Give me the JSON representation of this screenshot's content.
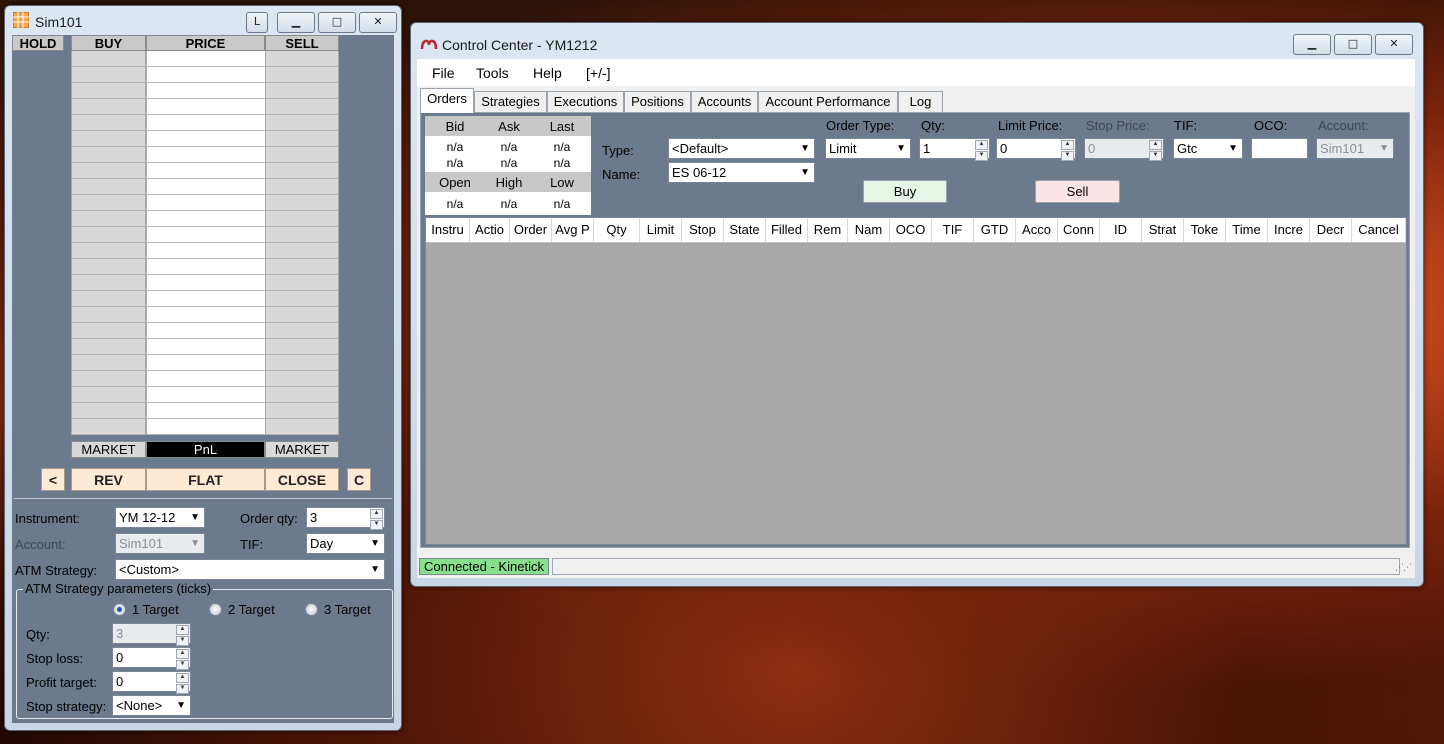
{
  "superdom": {
    "title": "Sim101",
    "lock_label": "L",
    "minimize_label": "▁",
    "maximize_label": "□",
    "close_label": "✕",
    "columns": [
      "HOLD",
      "BUY",
      "PRICE",
      "SELL"
    ],
    "bottom_labels": {
      "left": "MARKET",
      "center": "PnL",
      "right": "MARKET"
    },
    "actions": {
      "prev": "<",
      "rev": "REV",
      "flat": "FLAT",
      "close": "CLOSE",
      "c": "C"
    },
    "instrument_label": "Instrument:",
    "instrument_value": "YM 12-12",
    "order_qty_label": "Order qty:",
    "order_qty_value": "3",
    "account_label": "Account:",
    "account_value": "Sim101",
    "tif_label": "TIF:",
    "tif_value": "Day",
    "atm_label": "ATM Strategy:",
    "atm_value": "<Custom>",
    "atm_group_label": "ATM Strategy parameters (ticks)",
    "targets": [
      "1 Target",
      "2 Target",
      "3 Target"
    ],
    "selected_target": 0,
    "qty_label": "Qty:",
    "qty_value": "3",
    "stop_loss_label": "Stop loss:",
    "stop_loss_value": "0",
    "profit_target_label": "Profit target:",
    "profit_target_value": "0",
    "stop_strategy_label": "Stop strategy:",
    "stop_strategy_value": "<None>"
  },
  "control_center": {
    "title": "Control Center - YM1212",
    "menu": [
      "File",
      "Tools",
      "Help",
      "[+/-]"
    ],
    "tabs": [
      "Orders",
      "Strategies",
      "Executions",
      "Positions",
      "Accounts",
      "Account Performance",
      "Log"
    ],
    "active_tab": "Orders",
    "quote": {
      "headers1": [
        "Bid",
        "Ask",
        "Last"
      ],
      "row1": [
        "n/a",
        "n/a",
        "n/a"
      ],
      "row2": [
        "n/a",
        "n/a",
        "n/a"
      ],
      "headers2": [
        "Open",
        "High",
        "Low"
      ],
      "row3": [
        "n/a",
        "n/a",
        "n/a"
      ]
    },
    "order_form": {
      "type_label": "Type:",
      "type_value": "<Default>",
      "name_label": "Name:",
      "name_value": "ES 06-12",
      "order_type_label": "Order Type:",
      "order_type_value": "Limit",
      "qty_label": "Qty:",
      "qty_value": "1",
      "limit_price_label": "Limit Price:",
      "limit_price_value": "0",
      "stop_price_label": "Stop Price:",
      "stop_price_value": "0",
      "tif_label": "TIF:",
      "tif_value": "Gtc",
      "oco_label": "OCO:",
      "oco_value": "",
      "account_label": "Account:",
      "account_value": "Sim101",
      "buy_label": "Buy",
      "sell_label": "Sell"
    },
    "grid_columns": [
      "Instru",
      "Actio",
      "Order",
      "Avg P",
      "Qty",
      "Limit",
      "Stop",
      "State",
      "Filled",
      "Rem",
      "Nam",
      "OCO",
      "TIF",
      "GTD",
      "Acco",
      "Conn",
      "ID",
      "Strat",
      "Toke",
      "Time",
      "Incre",
      "Decr",
      "Cancel"
    ],
    "status": "Connected - Kinetick"
  },
  "colors": {
    "panel": "#6c7a8d",
    "flat_buttons": "#fde9d4",
    "connected": "#88e08c",
    "buy_button": "#e6f6e6",
    "sell_button": "#fbe3e6"
  }
}
